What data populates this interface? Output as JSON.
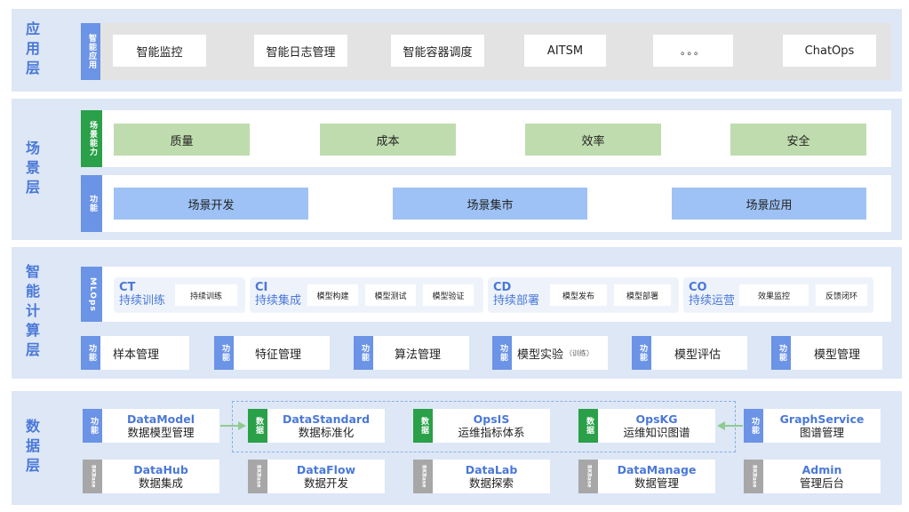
{
  "app_layer": {
    "title": "应用层",
    "tag": "智能应用",
    "items": [
      "智能监控",
      "智能日志管理",
      "智能容器调度",
      "AITSM",
      "。。。",
      "ChatOps"
    ]
  },
  "scene_layer": {
    "title": "场景层",
    "capability_tag": "场景能力",
    "capabilities": [
      "质量",
      "成本",
      "效率",
      "安全"
    ],
    "function_tag": "功能",
    "functions": [
      "场景开发",
      "场景集市",
      "场景应用"
    ]
  },
  "compute_layer": {
    "title": "智能计算层",
    "mlops_tag": "MLOps",
    "groups": [
      {
        "code": "CT",
        "name": "持续训练",
        "items": [
          "持续训练"
        ]
      },
      {
        "code": "CI",
        "name": "持续集成",
        "items": [
          "模型构建",
          "模型测试",
          "模型验证"
        ]
      },
      {
        "code": "CD",
        "name": "持续部署",
        "items": [
          "模型发布",
          "模型部署"
        ]
      },
      {
        "code": "CO",
        "name": "持续运营",
        "items": [
          "效果监控",
          "反馈闭环"
        ]
      }
    ],
    "function_tag": "功能",
    "functions": [
      {
        "label": "样本管理",
        "note": ""
      },
      {
        "label": "特征管理",
        "note": ""
      },
      {
        "label": "算法管理",
        "note": ""
      },
      {
        "label": "模型实验",
        "note": "（训练）"
      },
      {
        "label": "模型评估",
        "note": ""
      },
      {
        "label": "模型管理",
        "note": ""
      }
    ]
  },
  "data_layer": {
    "title": "数据层",
    "top_row": [
      {
        "tag": "功能",
        "en": "DataModel",
        "zh": "数据模型管理"
      },
      {
        "tag": "数据",
        "en": "DataStandard",
        "zh": "数据标准化"
      },
      {
        "tag": "数据",
        "en": "OpsIS",
        "zh": "运维指标体系"
      },
      {
        "tag": "数据",
        "en": "OpsKG",
        "zh": "运维知识图谱"
      },
      {
        "tag": "功能",
        "en": "GraphService",
        "zh": "图谱管理"
      }
    ],
    "bottom_row": [
      {
        "tag": "BKBase",
        "en": "DataHub",
        "zh": "数据集成"
      },
      {
        "tag": "BKBase",
        "en": "DataFlow",
        "zh": "数据开发"
      },
      {
        "tag": "BKBase",
        "en": "DataLab",
        "zh": "数据探索"
      },
      {
        "tag": "BKBase",
        "en": "DataManage",
        "zh": "数据管理"
      },
      {
        "tag": "BKBase",
        "en": "Admin",
        "zh": "管理后台"
      }
    ]
  },
  "colors": {
    "layer_bg": "#dde7f6",
    "accent_blue": "#4a78d8",
    "tag_blue": "#6b93e6",
    "tag_green": "#2aa048",
    "tag_gray": "#a7a7a7",
    "capability_green": "#bfdcae",
    "function_blue": "#9ec2f5",
    "arrow_green": "#8fcb8f"
  }
}
